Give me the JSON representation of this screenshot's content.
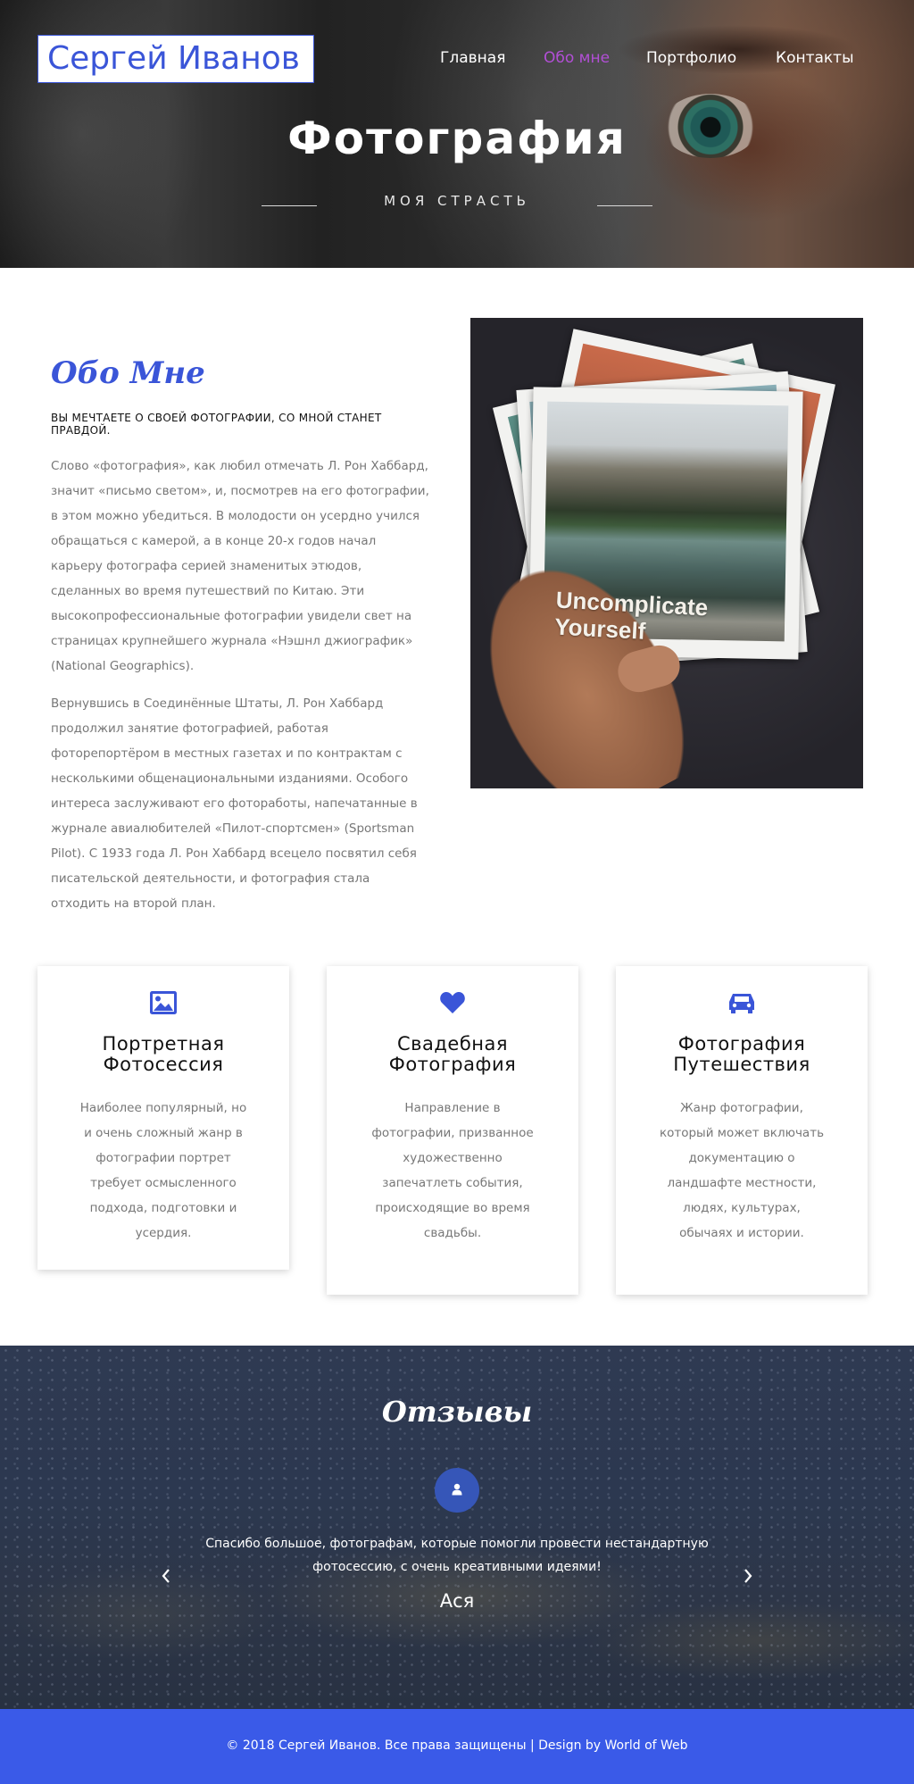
{
  "header": {
    "logo": "Сергей Иванов",
    "nav": [
      {
        "label": "Главная",
        "active": false
      },
      {
        "label": "Обо мне",
        "active": true
      },
      {
        "label": "Портфолио",
        "active": false
      },
      {
        "label": "Контакты",
        "active": false
      }
    ],
    "hero_title": "Фотография",
    "hero_subtitle": "МОЯ СТРАСТЬ"
  },
  "about": {
    "title": "Обо Мне",
    "tagline": "ВЫ МЕЧТАЕТЕ О СВОЕЙ ФОТОГРАФИИ, СО МНОЙ СТАНЕТ ПРАВДОЙ.",
    "paragraphs": [
      "Слово «фотография», как любил отмечать Л. Рон Хаббард, значит «письмо светом», и, посмотрев на его фотографии, в этом можно убедиться. В молодости он усердно учился обращаться с камерой, а в конце 20-х годов начал карьеру фотографа серией знаменитых этюдов, сделанных во время путешествий по Китаю. Эти высокопрофессиональные фотографии увидели свет на страницах крупнейшего журнала «Нэшнл джиографик» (National Geographics).",
      "Вернувшись в Соединённые Штаты, Л. Рон Хаббард продолжил занятие фотографией, работая фоторепортёром в местных газетах и по контрактам с несколькими общенациональными изданиями. Особого интереса заслуживают его фоторaботы, напечатанные в журнале авиалюбителей «Пилот-спортсмен» (Sportsman Pilot). С 1933 года Л. Рон Хаббард всецело посвятил себя писательской деятельности, и фотография стала отходить на второй план."
    ],
    "photo_caption_line1": "Uncomplicate",
    "photo_caption_line2": "Yourself"
  },
  "services": [
    {
      "icon": "image-icon",
      "title_line1": "Портретная",
      "title_line2": "Фотосессия",
      "description": "Наиболее популярный, но и очень сложный жанр в фотографии портрет требует осмысленного подхода, подготовки и усердия."
    },
    {
      "icon": "heart-icon",
      "title_line1": "Свадебная",
      "title_line2": "Фотография",
      "description": "Направление в фотографии, призванное художественно запечатлеть события, происходящие во время свадьбы."
    },
    {
      "icon": "car-icon",
      "title_line1": "Фотография",
      "title_line2": "Путешествия",
      "description": "Жанр фотографии, который может включать документацию о ландшафте местности, людях, культурах, обычаях и истории."
    }
  ],
  "testimonials": {
    "title": "Отзывы",
    "quote": "Спасибо большое, фотографам, которые помогли провести нестандартную фотосессию, с очень креативными идеями!",
    "author": "Ася"
  },
  "footer": {
    "text": "© 2018 Сергей Иванов. Все права защищены | Design by World of Web"
  },
  "colors": {
    "accent": "#3a55d8",
    "nav_active": "#b24fd6",
    "footer_bg": "#3a5ae8"
  }
}
